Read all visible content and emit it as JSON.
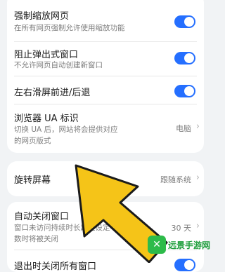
{
  "settings": {
    "force_zoom": {
      "title": "强制缩放网页",
      "desc": "在所有网页强制允许使用缩放功能",
      "enabled": true
    },
    "block_popups": {
      "title": "阻止弹出式窗口",
      "desc": "不允许网页自动创建新窗口",
      "enabled": true
    },
    "swipe_nav": {
      "title": "左右滑屏前进/后退",
      "enabled": true
    },
    "ua": {
      "title": "浏览器 UA 标识",
      "desc_line1": "切换 UA 后，网站将会提供对应",
      "desc_line2": "的网页版式",
      "value": "电脑"
    },
    "rotate": {
      "title": "旋转屏幕",
      "value": "跟随系统"
    },
    "auto_close": {
      "title": "自动关闭窗口",
      "desc_line1": "窗口未访问持续时长超过设定",
      "desc_line2": "数时将被关闭",
      "value": "30 天"
    },
    "exit_close": {
      "title": "退出时关闭所有窗口"
    }
  },
  "icons": {
    "chevron": "›"
  },
  "watermark": {
    "text": "远景手游网"
  },
  "colors": {
    "toggle_on": "#256fff",
    "arrow": "#f5c418"
  }
}
